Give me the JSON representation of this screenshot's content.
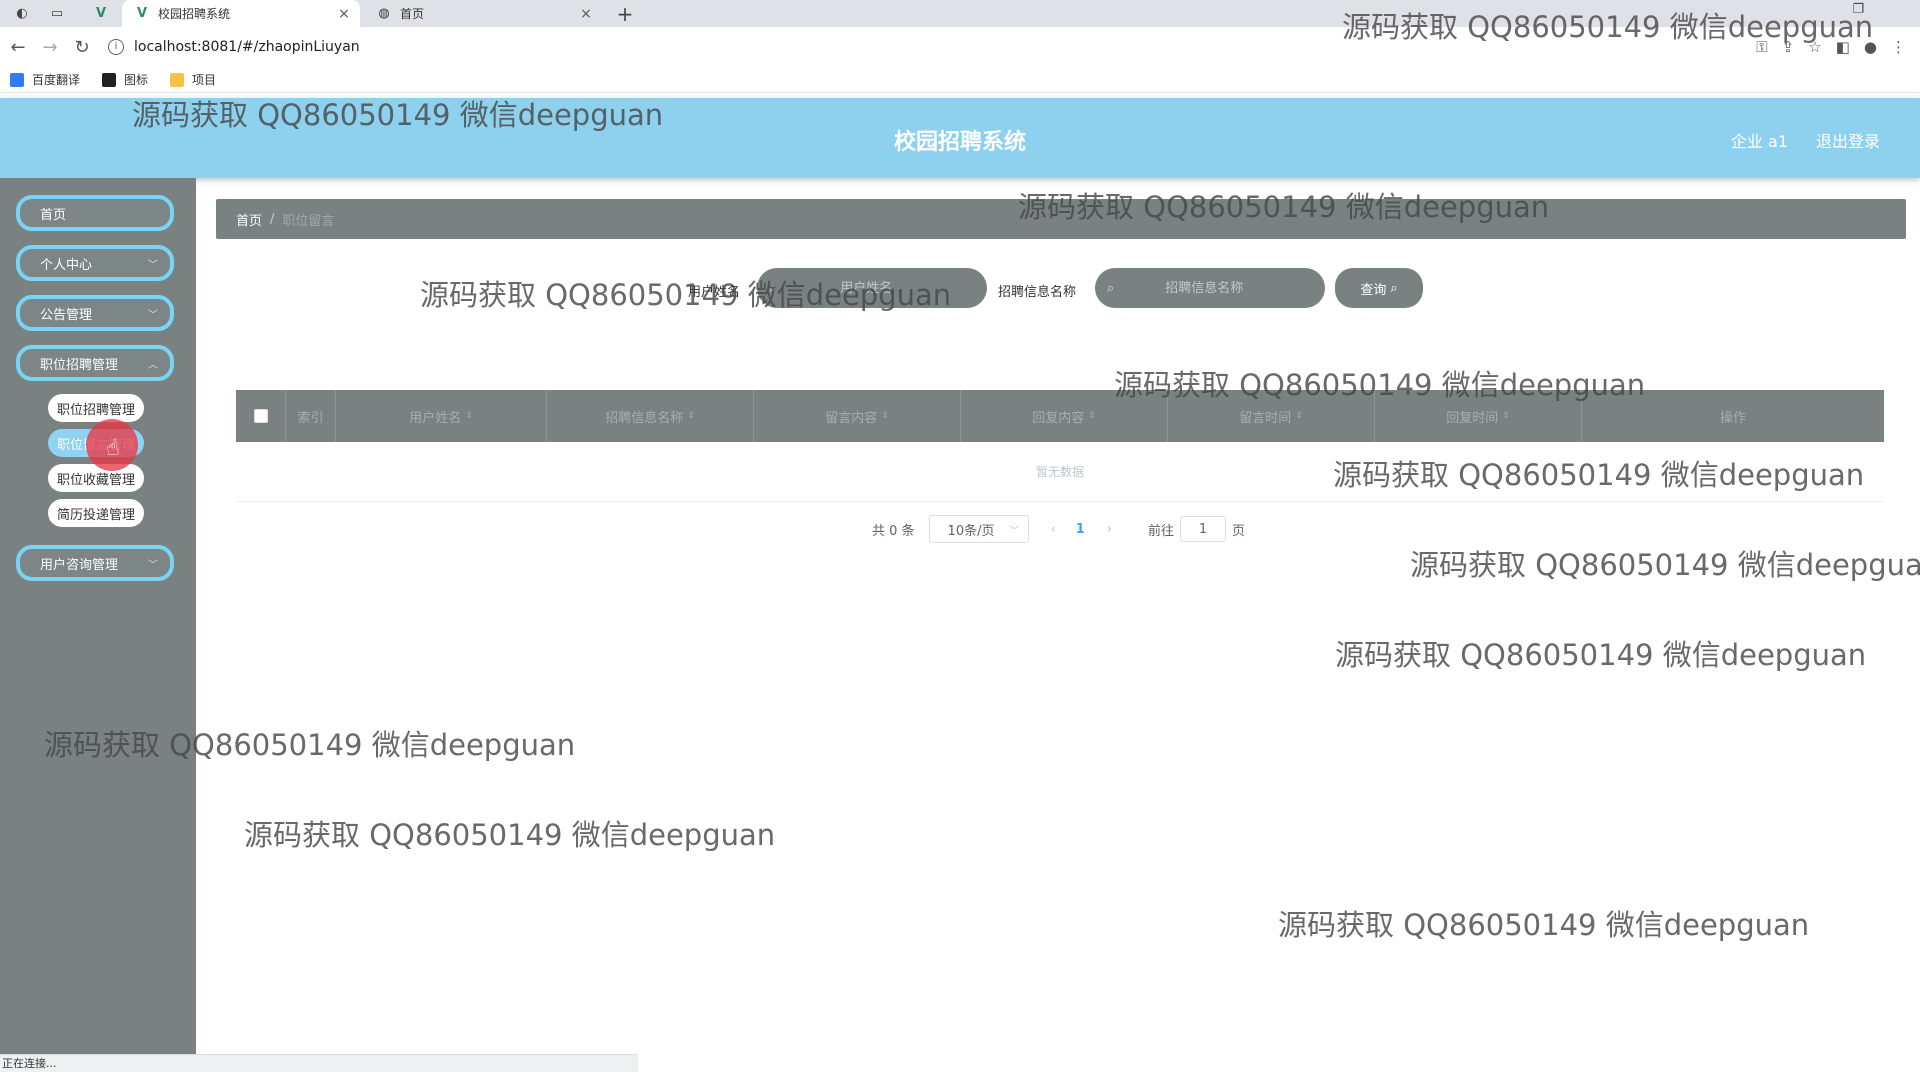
{
  "browser": {
    "tabs": [
      {
        "title": "校园招聘系统",
        "active": true
      },
      {
        "title": "首页",
        "active": false
      }
    ],
    "new_tab": "+",
    "url": "localhost:8081/#/zhaopinLiuyan",
    "bookmarks": [
      "百度翻译",
      "图标",
      "项目"
    ],
    "status": "正在连接..."
  },
  "header": {
    "title": "校园招聘系统",
    "user": "企业 a1",
    "logout": "退出登录"
  },
  "sidebar": {
    "items": [
      {
        "label": "首页"
      },
      {
        "label": "个人中心"
      },
      {
        "label": "公告管理"
      },
      {
        "label": "职位招聘管理"
      },
      {
        "label": "用户咨询管理"
      }
    ],
    "sub_items": [
      {
        "label": "职位招聘管理",
        "active": false
      },
      {
        "label": "职位留言管理",
        "active": true
      },
      {
        "label": "职位收藏管理",
        "active": false
      },
      {
        "label": "简历投递管理",
        "active": false
      }
    ]
  },
  "breadcrumb": {
    "home": "首页",
    "separator": "/",
    "current": "职位留言"
  },
  "search": {
    "field1_label": "用户姓名",
    "field1_placeholder": "用户姓名",
    "field2_label": "招聘信息名称",
    "field2_placeholder": "招聘信息名称",
    "query_label": "查询"
  },
  "table": {
    "columns": [
      "索引",
      "用户姓名",
      "招聘信息名称",
      "留言内容",
      "回复内容",
      "留言时间",
      "回复时间",
      "操作"
    ],
    "empty_text": "暂无数据"
  },
  "pagination": {
    "total": "共 0 条",
    "page_size": "10条/页",
    "current_page": "1",
    "goto_label": "前往",
    "goto_value": "1",
    "page_suffix": "页"
  },
  "watermark": "源码获取 QQ86050149 微信deepguan",
  "colors": {
    "header": "#8dd1ef",
    "sidebar": "#798181",
    "menu_border": "#7ad4f5",
    "cursor": "#e53946"
  }
}
